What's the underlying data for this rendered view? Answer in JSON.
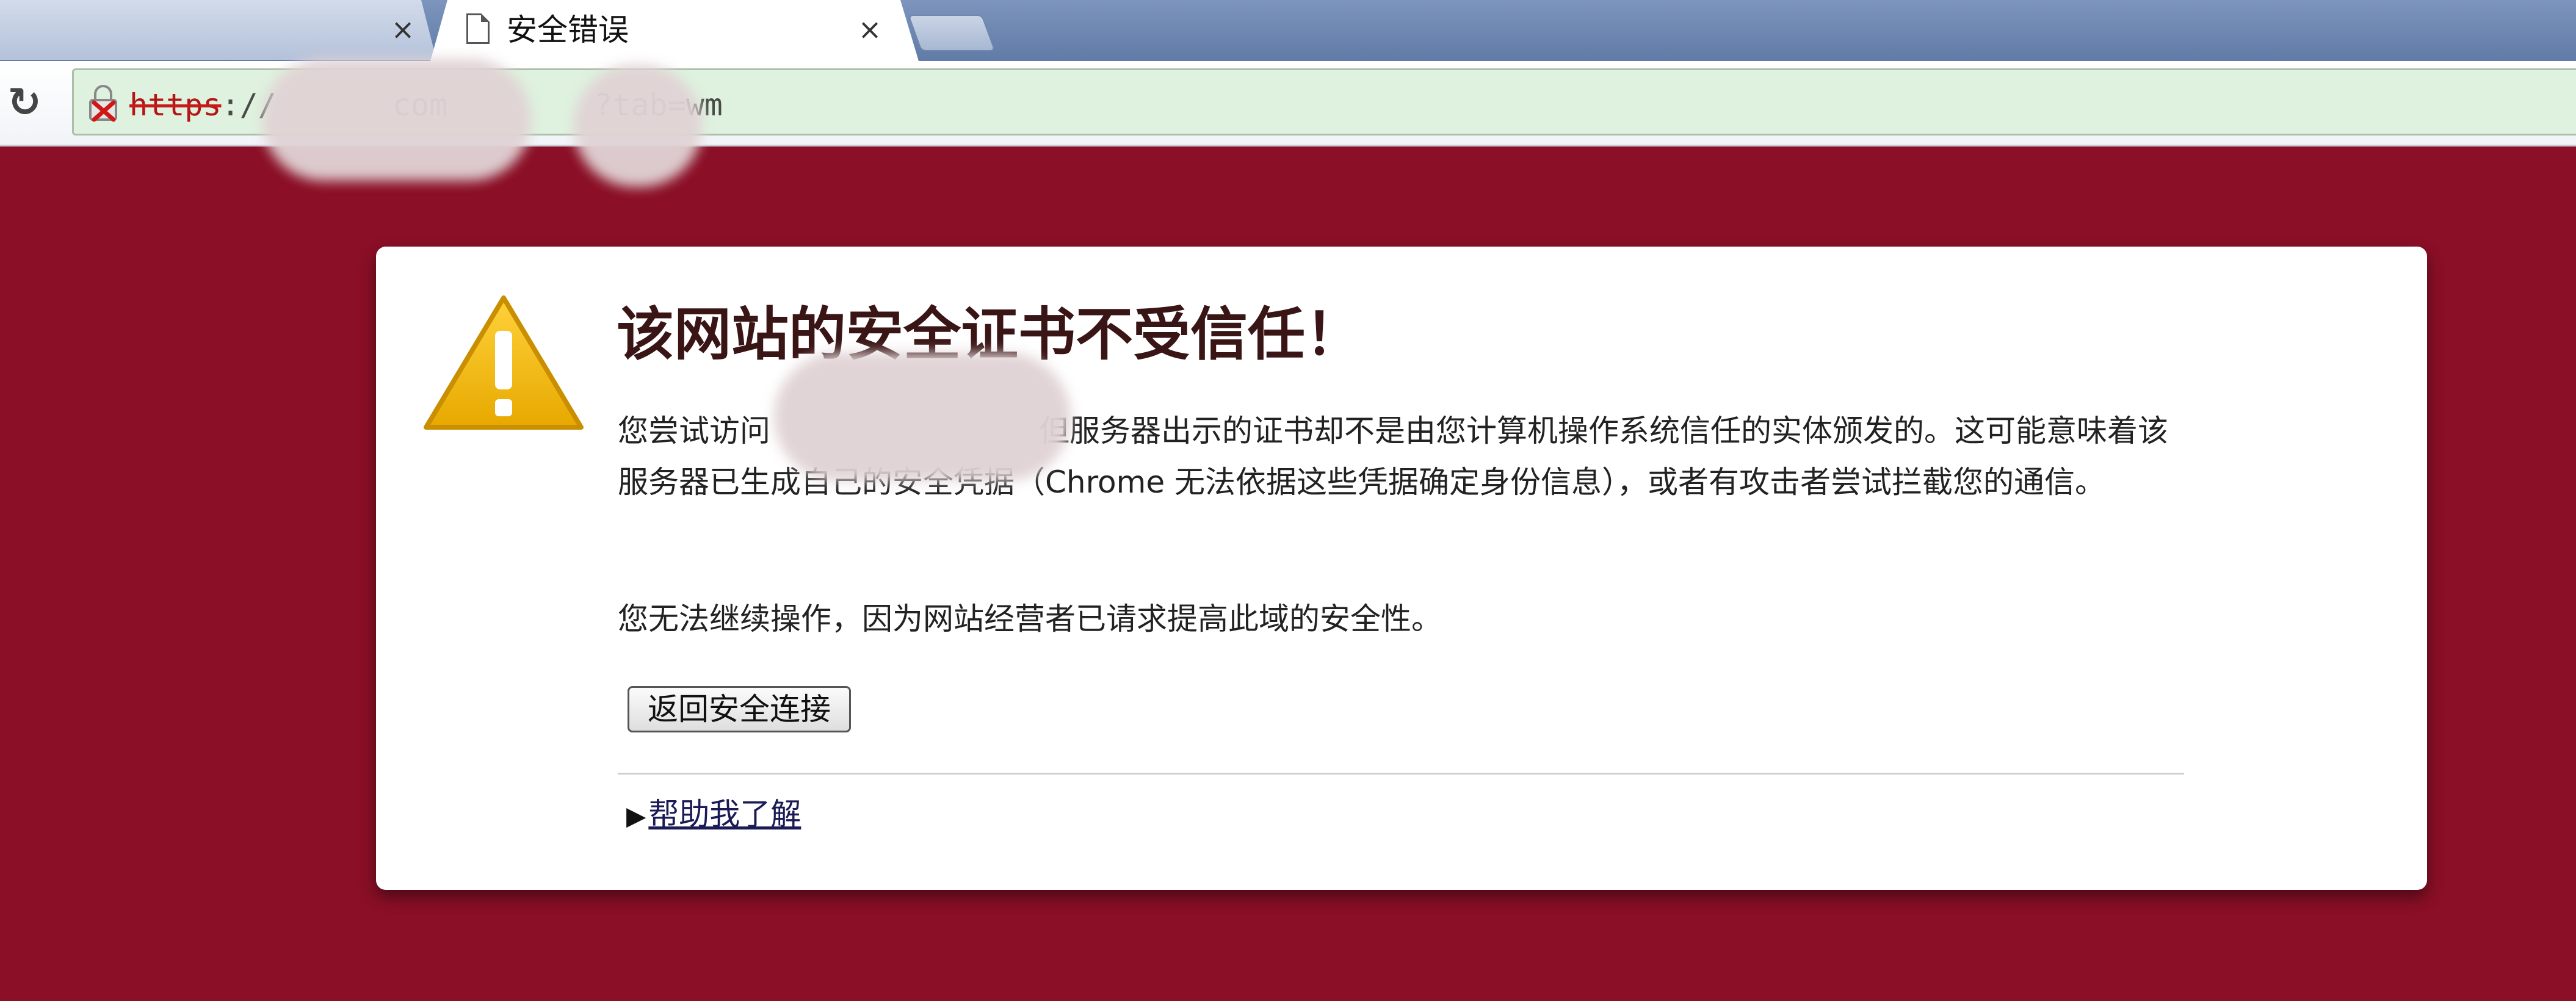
{
  "browser": {
    "tab_title": "安全错误",
    "close_glyph": "×",
    "url_scheme": "https",
    "url_sep": "://",
    "url_mid": "com",
    "url_query": "?tab=wm"
  },
  "error": {
    "heading": "该网站的安全证书不受信任！",
    "p1_prefix": "您尝试访问",
    "p1_rest": "但服务器出示的证书却不是由您计算机操作系统信任的实体颁发的。这可能意味着该服务器已生成自己的安全凭据（Chrome 无法依据这些凭据确定身份信息），或者有攻击者尝试拦截您的通信。",
    "p2": "您无法继续操作，因为网站经营者已请求提高此域的安全性。",
    "back_button": "返回安全连接",
    "help_link": "帮助我了解"
  },
  "colors": {
    "page_background": "#8b0f26",
    "omnibox_background": "#dff2df",
    "warning_yellow": "#f2b705"
  },
  "icons": {
    "tab": "document-icon",
    "reload": "reload-icon",
    "security": "broken-lock-icon",
    "warning": "warning-triangle-icon",
    "expand": "triangle-right-icon"
  }
}
